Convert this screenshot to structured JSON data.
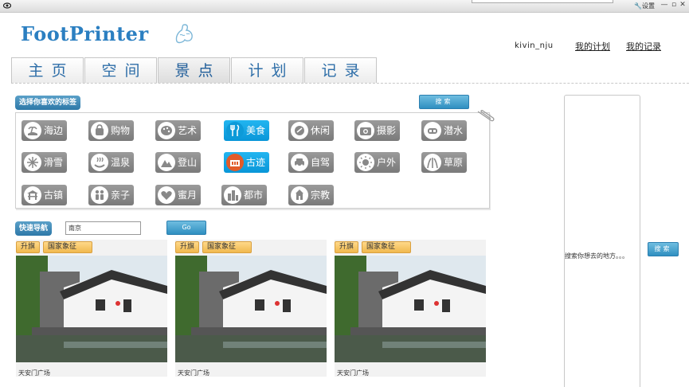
{
  "titlebar": {
    "settings_label": "设置",
    "minimize": "—",
    "restore": "▫",
    "close": "✕"
  },
  "app": {
    "logo_text": "FootPrinter"
  },
  "user": {
    "name": "kivin_nju",
    "my_plan": "我的计划",
    "my_record": "我的记录"
  },
  "tabs": [
    {
      "label": "主页",
      "active": false
    },
    {
      "label": "空间",
      "active": false
    },
    {
      "label": "景点",
      "active": true
    },
    {
      "label": "计划",
      "active": false
    },
    {
      "label": "记录",
      "active": false
    }
  ],
  "tag_section": {
    "title": "选择你喜欢的标签",
    "search_button": "搜索",
    "tags": [
      {
        "label": "海边",
        "icon": "beach-icon",
        "active": false
      },
      {
        "label": "购物",
        "icon": "shopping-bag-icon",
        "active": false
      },
      {
        "label": "艺术",
        "icon": "palette-icon",
        "active": false
      },
      {
        "label": "美食",
        "icon": "fork-knife-icon",
        "active": true
      },
      {
        "label": "休闲",
        "icon": "leisure-icon",
        "active": false
      },
      {
        "label": "摄影",
        "icon": "camera-icon",
        "active": false
      },
      {
        "label": "潜水",
        "icon": "diving-mask-icon",
        "active": false
      },
      {
        "label": "滑雪",
        "icon": "snowflake-icon",
        "active": false
      },
      {
        "label": "温泉",
        "icon": "hot-spring-icon",
        "active": false
      },
      {
        "label": "登山",
        "icon": "mountain-icon",
        "active": false
      },
      {
        "label": "古迹",
        "icon": "colosseum-icon",
        "active": true
      },
      {
        "label": "自驾",
        "icon": "car-icon",
        "active": false
      },
      {
        "label": "户外",
        "icon": "sun-icon",
        "active": false
      },
      {
        "label": "草原",
        "icon": "grass-icon",
        "active": false
      },
      {
        "label": "古镇",
        "icon": "ancient-town-icon",
        "active": false
      },
      {
        "label": "亲子",
        "icon": "family-icon",
        "active": false
      },
      {
        "label": "蜜月",
        "icon": "heart-icon",
        "active": false
      },
      {
        "label": "都市",
        "icon": "city-icon",
        "active": false
      },
      {
        "label": "宗教",
        "icon": "temple-icon",
        "active": false
      }
    ]
  },
  "quick_nav": {
    "title": "快速导航",
    "input_value": "南京",
    "go_button": "Go"
  },
  "cards": [
    {
      "badges": [
        "升旗",
        "国家象征"
      ],
      "caption": "天安门广场"
    },
    {
      "badges": [
        "升旗",
        "国家象征"
      ],
      "caption": "天安门广场"
    },
    {
      "badges": [
        "升旗",
        "国家象征"
      ],
      "caption": "天安门广场"
    }
  ],
  "side": {
    "hint": "搜索你想去的地方。。。",
    "search_button": "搜索"
  },
  "colors": {
    "accent": "#2b7fc1",
    "tag_active": "#0fa3e3",
    "tag_inactive": "#8a8a8a",
    "badge": "#f5c060"
  }
}
